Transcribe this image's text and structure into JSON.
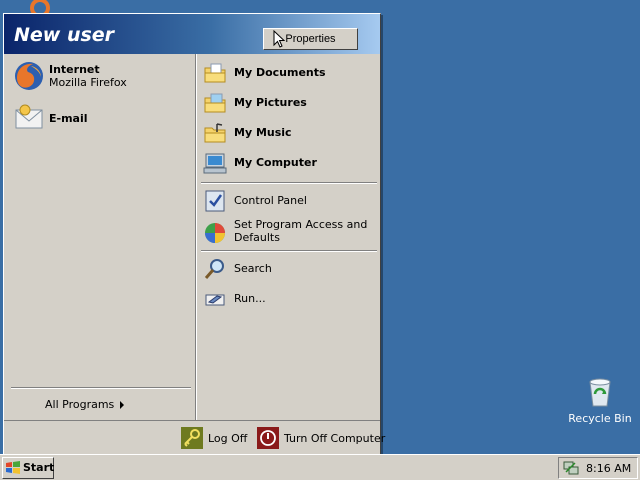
{
  "desktop": {
    "recycle_bin_label": "Recycle Bin"
  },
  "start_menu": {
    "user_name": "New user",
    "properties_label": "Properties",
    "pinned": [
      {
        "title": "Internet",
        "subtitle": "Mozilla Firefox",
        "icon": "firefox-icon"
      },
      {
        "title": "E-mail",
        "subtitle": "",
        "icon": "email-icon"
      }
    ],
    "all_programs_label": "All Programs",
    "places": [
      {
        "label": "My Documents",
        "icon": "folder-documents-icon"
      },
      {
        "label": "My Pictures",
        "icon": "folder-pictures-icon"
      },
      {
        "label": "My Music",
        "icon": "folder-music-icon"
      },
      {
        "label": "My Computer",
        "icon": "computer-icon"
      }
    ],
    "settings": [
      {
        "label": "Control Panel",
        "icon": "control-panel-icon"
      },
      {
        "label": "Set Program Access and Defaults",
        "icon": "program-access-icon"
      }
    ],
    "tools": [
      {
        "label": "Search",
        "icon": "search-icon"
      },
      {
        "label": "Run...",
        "icon": "run-icon"
      }
    ],
    "footer": {
      "log_off_label": "Log Off",
      "turn_off_label": "Turn Off Computer"
    }
  },
  "taskbar": {
    "start_label": "Start",
    "clock": "8:16 AM"
  },
  "colors": {
    "desktop": "#3a6ea5",
    "menu_bg": "#d4d0c8",
    "header_dark": "#0a246a"
  }
}
